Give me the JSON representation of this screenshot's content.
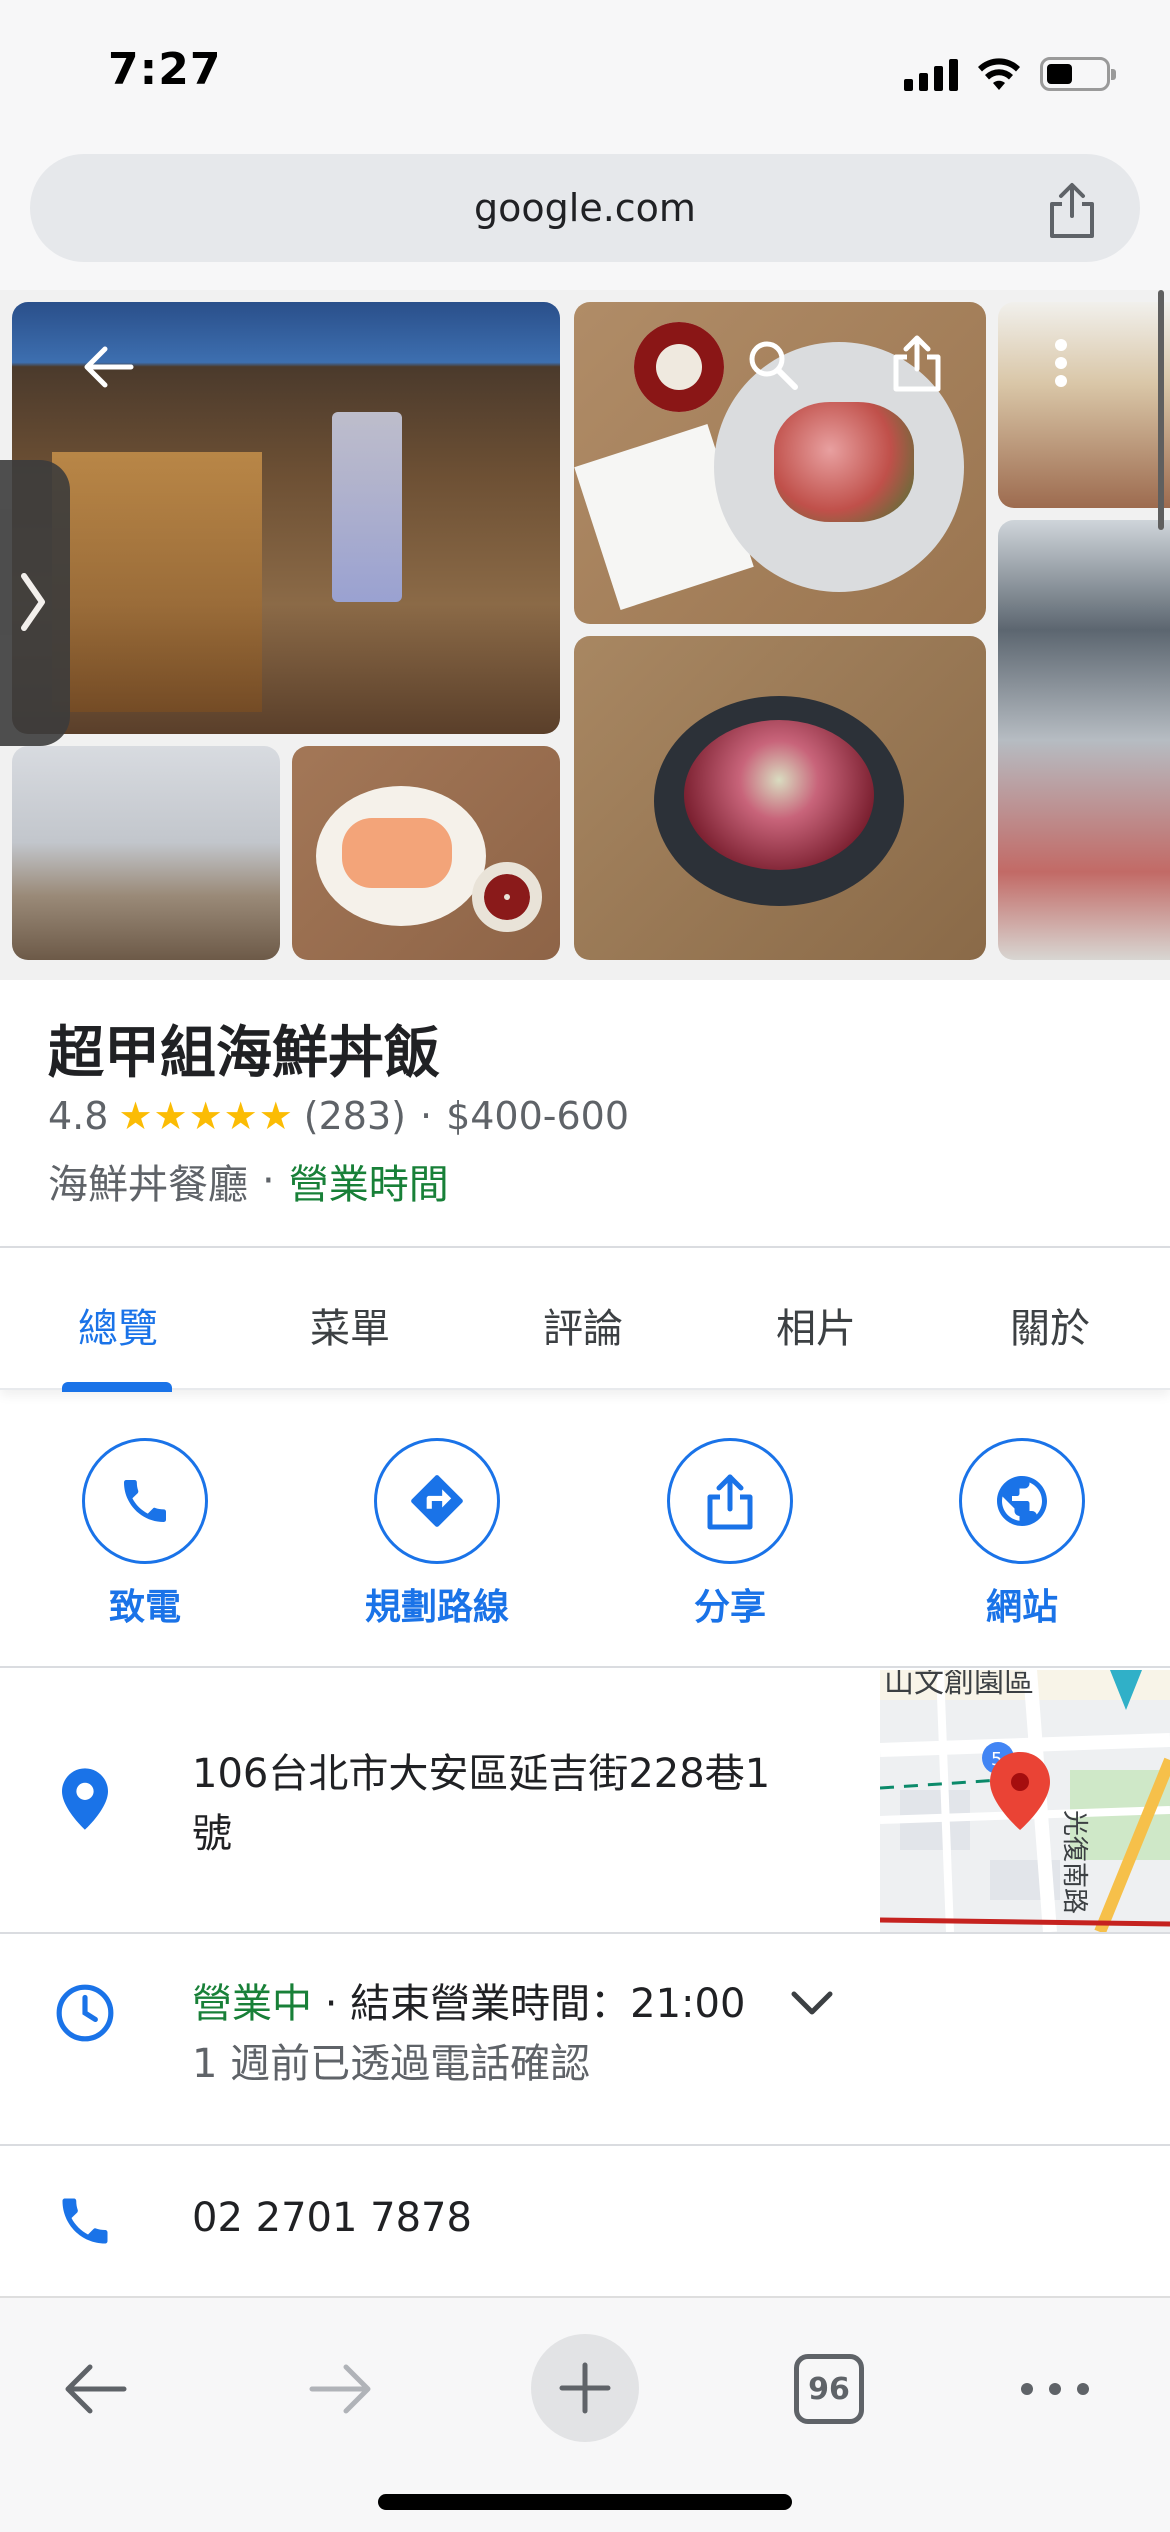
{
  "status_bar": {
    "time": "7:27",
    "battery_level": 0.45
  },
  "browser": {
    "url": "google.com"
  },
  "place": {
    "name": "超甲組海鮮丼飯",
    "rating": "4.8",
    "stars_glyphs": "★★★★★",
    "review_count": "(283)",
    "price_range": "$400-600",
    "category": "海鮮丼餐廳",
    "hours_link": "營業時間"
  },
  "tabs": [
    {
      "label": "總覽",
      "active": true
    },
    {
      "label": "菜單",
      "active": false
    },
    {
      "label": "評論",
      "active": false
    },
    {
      "label": "相片",
      "active": false
    },
    {
      "label": "關於",
      "active": false
    }
  ],
  "actions": [
    {
      "label": "致電",
      "icon": "phone-icon"
    },
    {
      "label": "規劃路線",
      "icon": "directions-icon"
    },
    {
      "label": "分享",
      "icon": "share-icon"
    },
    {
      "label": "網站",
      "icon": "globe-icon"
    }
  ],
  "address": {
    "line1": "106台北市大安區延吉街228巷1",
    "line2": "號",
    "map_labels": {
      "top": "山文創園區",
      "road": "光復南路",
      "route_badge": "5"
    }
  },
  "hours": {
    "status": "營業中",
    "separator": " · ",
    "closing": "結束營業時間：21:00",
    "verified": "1 週前已透過電話確認"
  },
  "phone": {
    "number": "02 2701 7878"
  },
  "toolbar": {
    "tab_count": "96"
  },
  "colors": {
    "accent_blue": "#1a73e8",
    "open_green": "#188038",
    "star_yellow": "#fbbc04",
    "pin_red": "#ea4335"
  }
}
